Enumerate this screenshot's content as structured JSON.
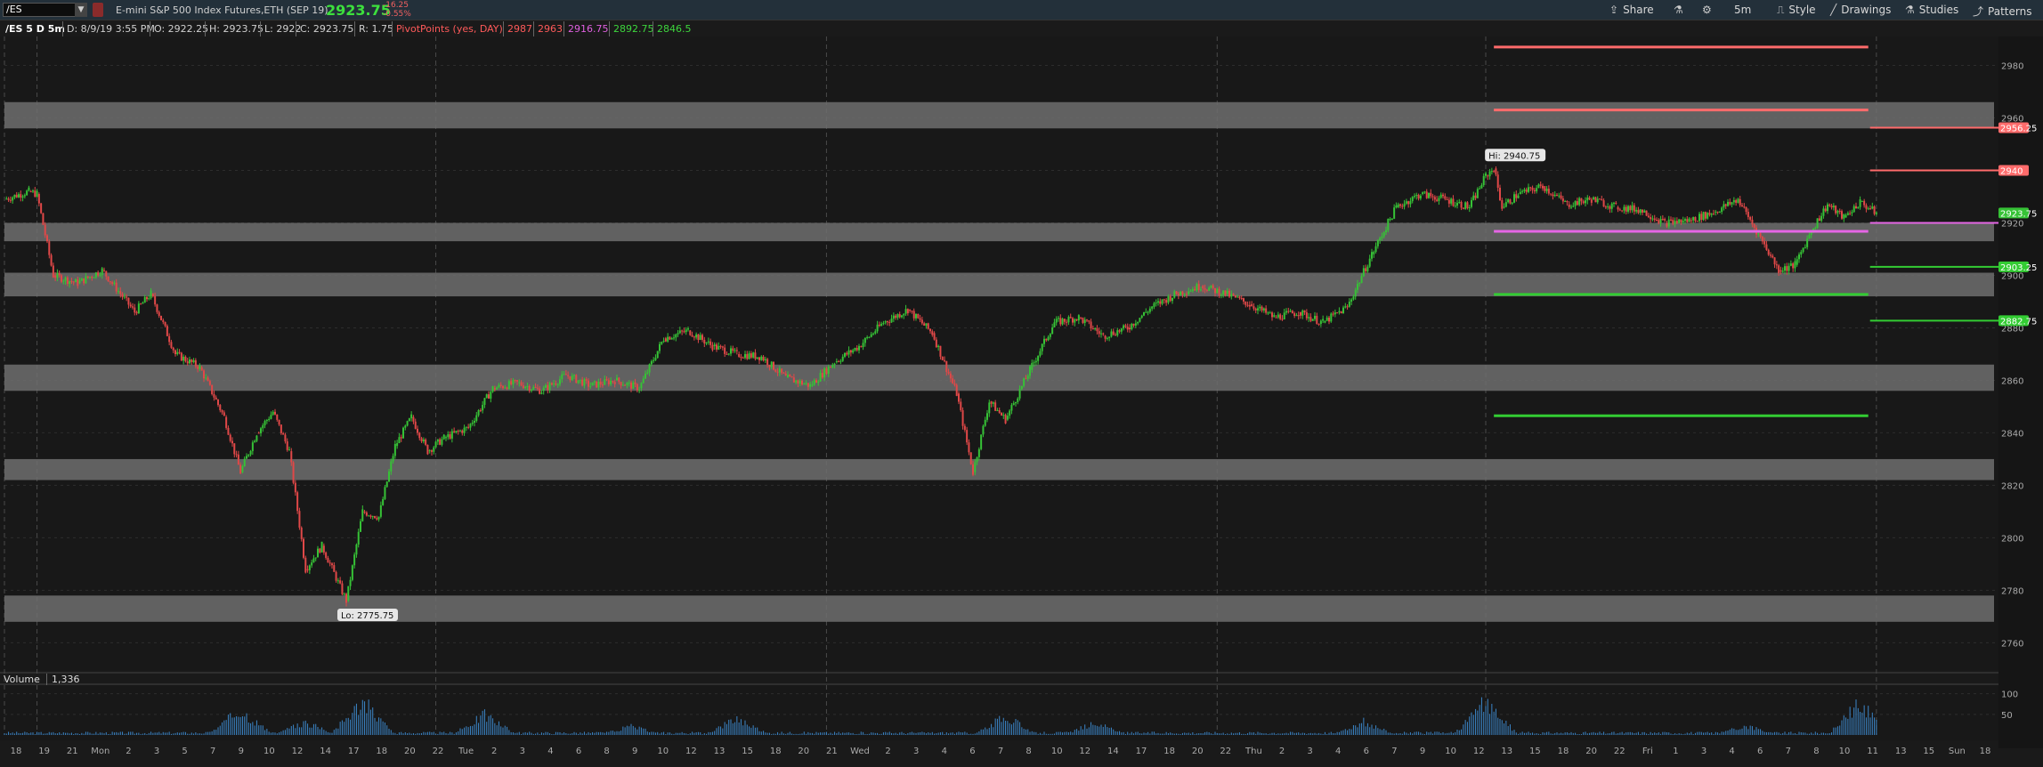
{
  "header": {
    "symbol": "/ES",
    "description": "E-mini S&P 500 Index Futures,ETH (SEP 19)",
    "last": "2923.75",
    "change": "-16.25",
    "change_pct": "-0.55%",
    "toolbar": {
      "share": "Share",
      "interval": "5m",
      "style": "Style",
      "drawings": "Drawings",
      "studies": "Studies",
      "patterns": "Patterns"
    }
  },
  "infobar": {
    "symbol_period": "/ES 5 D 5m",
    "date": "D: 8/9/19 3:55 PM",
    "open": "O: 2922.25",
    "high": "H: 2923.75",
    "low": "L: 2922",
    "close": "C: 2923.75",
    "range": "R: 1.75",
    "study": "PivotPoints (yes, DAY)",
    "pivots": [
      {
        "text": "2987",
        "color": "#ff5a5a"
      },
      {
        "text": "2963",
        "color": "#ff5a5a"
      },
      {
        "text": "2916.75",
        "color": "#e060e0"
      },
      {
        "text": "2892.75",
        "color": "#3dd63d"
      },
      {
        "text": "2846.5",
        "color": "#3dd63d"
      }
    ]
  },
  "colors": {
    "resistance": "#ff6b6b",
    "pivot": "#e566e5",
    "support": "#33cc33",
    "zone": "#6e6e6e",
    "up_candle": "#36c236",
    "down_candle": "#e04848",
    "volume": "#3b86c9"
  },
  "chart_data": {
    "type": "candlestick",
    "ylim": [
      2752,
      2990
    ],
    "y_ticks": [
      2760,
      2780,
      2800,
      2820,
      2840,
      2860,
      2880,
      2900,
      2920,
      2940,
      2960,
      2980
    ],
    "x_ticks": [
      "18",
      "19",
      "21",
      "Mon",
      "2",
      "3",
      "5",
      "7",
      "9",
      "10",
      "12",
      "14",
      "17",
      "18",
      "20",
      "22",
      "Tue",
      "2",
      "3",
      "4",
      "6",
      "8",
      "9",
      "10",
      "12",
      "13",
      "15",
      "18",
      "20",
      "21",
      "Wed",
      "2",
      "3",
      "4",
      "6",
      "7",
      "8",
      "10",
      "12",
      "14",
      "17",
      "18",
      "20",
      "22",
      "Thu",
      "2",
      "3",
      "4",
      "6",
      "7",
      "9",
      "10",
      "12",
      "13",
      "15",
      "18",
      "20",
      "22",
      "Fri",
      "1",
      "3",
      "4",
      "6",
      "7",
      "8",
      "10",
      "11",
      "13",
      "15",
      "Sun",
      "18"
    ],
    "sessions": [
      {
        "label": "Sun",
        "start": 2930,
        "end": 2928
      },
      {
        "label": "Mon",
        "start": 2928,
        "end": 2845
      },
      {
        "label": "Tue",
        "start": 2845,
        "end": 2862
      },
      {
        "label": "Wed",
        "start": 2862,
        "end": 2880
      },
      {
        "label": "Thu",
        "start": 2880,
        "end": 2937
      },
      {
        "label": "Fri",
        "start": 2937,
        "end": 2923.75
      }
    ],
    "path": [
      [
        0,
        2929
      ],
      [
        3,
        2932
      ],
      [
        4,
        2931
      ],
      [
        6,
        2900
      ],
      [
        9,
        2897
      ],
      [
        12,
        2902
      ],
      [
        16,
        2886
      ],
      [
        18,
        2893
      ],
      [
        21,
        2870
      ],
      [
        24,
        2865
      ],
      [
        27,
        2846
      ],
      [
        29,
        2825
      ],
      [
        31,
        2840
      ],
      [
        33,
        2848
      ],
      [
        35,
        2833
      ],
      [
        37,
        2788
      ],
      [
        39,
        2797
      ],
      [
        42,
        2776
      ],
      [
        44,
        2810
      ],
      [
        46,
        2808
      ],
      [
        48,
        2835
      ],
      [
        50,
        2846
      ],
      [
        52,
        2833
      ],
      [
        54,
        2838
      ],
      [
        57,
        2842
      ],
      [
        60,
        2857
      ],
      [
        63,
        2859
      ],
      [
        66,
        2856
      ],
      [
        69,
        2862
      ],
      [
        72,
        2858
      ],
      [
        75,
        2860
      ],
      [
        78,
        2857
      ],
      [
        81,
        2876
      ],
      [
        84,
        2879
      ],
      [
        87,
        2873
      ],
      [
        90,
        2870
      ],
      [
        93,
        2869
      ],
      [
        96,
        2861
      ],
      [
        99,
        2858
      ],
      [
        102,
        2867
      ],
      [
        105,
        2873
      ],
      [
        108,
        2882
      ],
      [
        111,
        2887
      ],
      [
        114,
        2878
      ],
      [
        117,
        2855
      ],
      [
        119,
        2825
      ],
      [
        121,
        2852
      ],
      [
        123,
        2845
      ],
      [
        126,
        2864
      ],
      [
        129,
        2882
      ],
      [
        132,
        2884
      ],
      [
        135,
        2877
      ],
      [
        138,
        2880
      ],
      [
        141,
        2888
      ],
      [
        144,
        2893
      ],
      [
        147,
        2896
      ],
      [
        150,
        2893
      ],
      [
        153,
        2889
      ],
      [
        156,
        2884
      ],
      [
        159,
        2886
      ],
      [
        162,
        2882
      ],
      [
        165,
        2888
      ],
      [
        168,
        2908
      ],
      [
        171,
        2926
      ],
      [
        174,
        2931
      ],
      [
        177,
        2929
      ],
      [
        180,
        2926
      ],
      [
        182,
        2938
      ],
      [
        183,
        2940.75
      ],
      [
        184,
        2926
      ],
      [
        186,
        2931
      ],
      [
        189,
        2934
      ],
      [
        192,
        2927
      ],
      [
        195,
        2929
      ],
      [
        198,
        2926
      ],
      [
        201,
        2925
      ],
      [
        204,
        2920
      ],
      [
        207,
        2921
      ],
      [
        210,
        2924
      ],
      [
        213,
        2929
      ],
      [
        216,
        2913
      ],
      [
        218,
        2902
      ],
      [
        220,
        2904
      ],
      [
        222,
        2917
      ],
      [
        224,
        2927
      ],
      [
        226,
        2922
      ],
      [
        228,
        2928
      ],
      [
        230,
        2923.75
      ]
    ],
    "x_max": 245,
    "zones": [
      [
        2956,
        2966
      ],
      [
        2913,
        2920
      ],
      [
        2892,
        2901
      ],
      [
        2856,
        2866
      ],
      [
        2822,
        2830
      ],
      [
        2768,
        2778
      ]
    ],
    "pivot_lines": {
      "start_x": 183,
      "end_x": 229,
      "levels": [
        {
          "value": 2987,
          "role": "resistance"
        },
        {
          "value": 2963,
          "role": "resistance"
        },
        {
          "value": 2916.75,
          "role": "pivot"
        },
        {
          "value": 2892.75,
          "role": "support"
        },
        {
          "value": 2846.5,
          "role": "support"
        }
      ]
    },
    "right_segments": [
      {
        "value": 2956.25,
        "role": "resistance",
        "label": "2956.25"
      },
      {
        "value": 2940,
        "role": "resistance",
        "label": "2940"
      },
      {
        "value": 2920,
        "role": "pivot",
        "label": ""
      },
      {
        "value": 2903.25,
        "role": "support",
        "label": "2903.25"
      },
      {
        "value": 2882.75,
        "role": "support",
        "label": "2882.75"
      }
    ],
    "last_label": "2923.75",
    "annotations": [
      {
        "text": "Hi: 2940.75",
        "x": 183,
        "y": 2940.75,
        "pos": "above"
      },
      {
        "text": "Lo: 2775.75",
        "x": 42,
        "y": 2775.75,
        "pos": "below"
      }
    ],
    "volume": {
      "label": "Volume",
      "last": "1,336",
      "y_ticks": [
        50,
        100
      ],
      "ymax": 110,
      "spikes": [
        [
          29,
          80
        ],
        [
          37,
          40
        ],
        [
          44,
          108
        ],
        [
          59,
          65
        ],
        [
          77,
          28
        ],
        [
          90,
          55
        ],
        [
          123,
          58
        ],
        [
          134,
          38
        ],
        [
          167,
          42
        ],
        [
          182,
          108
        ],
        [
          214,
          30
        ],
        [
          228,
          100
        ]
      ]
    }
  }
}
